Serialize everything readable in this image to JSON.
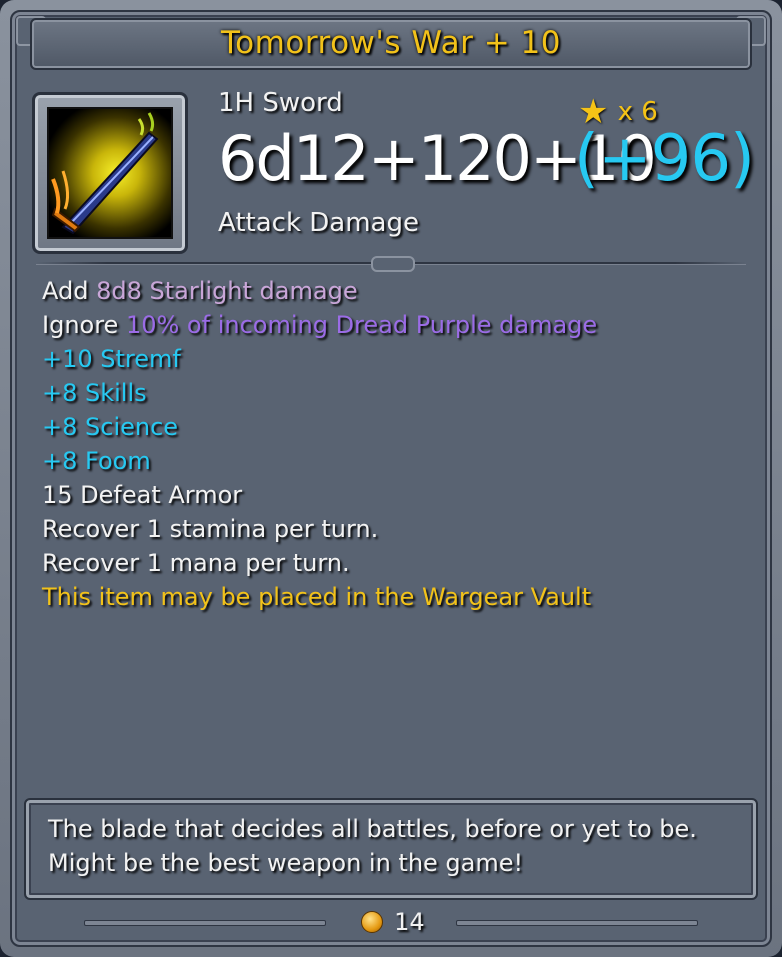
{
  "item": {
    "title": "Tomorrow's War + 10",
    "type": "1H Sword",
    "damage": "6d12+120+10",
    "bonus": "(+96)",
    "damage_label": "Attack Damage",
    "stars": {
      "icon": "star-icon",
      "count_text": "x 6"
    },
    "icon": "sword-icon"
  },
  "stats": [
    {
      "prefix": "Add",
      "highlight": "8d8 Starlight damage",
      "color": "lavender"
    },
    {
      "prefix": "Ignore",
      "highlight": "10% of incoming Dread Purple damage",
      "color": "purple"
    },
    {
      "prefix": "",
      "highlight": "+10 Stremf",
      "color": "cyan"
    },
    {
      "prefix": "",
      "highlight": "+8 Skills",
      "color": "cyan"
    },
    {
      "prefix": "",
      "highlight": "+8 Science",
      "color": "cyan"
    },
    {
      "prefix": "",
      "highlight": "+8 Foom",
      "color": "cyan"
    },
    {
      "prefix": "15 Defeat Armor",
      "highlight": "",
      "color": "white"
    },
    {
      "prefix": "Recover 1 stamina per turn.",
      "highlight": "",
      "color": "white"
    },
    {
      "prefix": "Recover 1 mana per turn.",
      "highlight": "",
      "color": "white"
    },
    {
      "prefix": "",
      "highlight": "This item may be placed in the Wargear Vault",
      "color": "yellow"
    }
  ],
  "description": "The blade that decides all battles, before or yet to be. Might be the best weapon in the game!",
  "footer": {
    "coin_icon": "coin-icon",
    "coin_count": "14"
  },
  "colors": {
    "title": "#f2c21a",
    "bonus": "#27c9f2",
    "lavender": "#c9a6d8",
    "purple": "#9b6ce6",
    "cyan": "#27c9f2",
    "yellow": "#f2c21a",
    "panel": "#596372"
  }
}
